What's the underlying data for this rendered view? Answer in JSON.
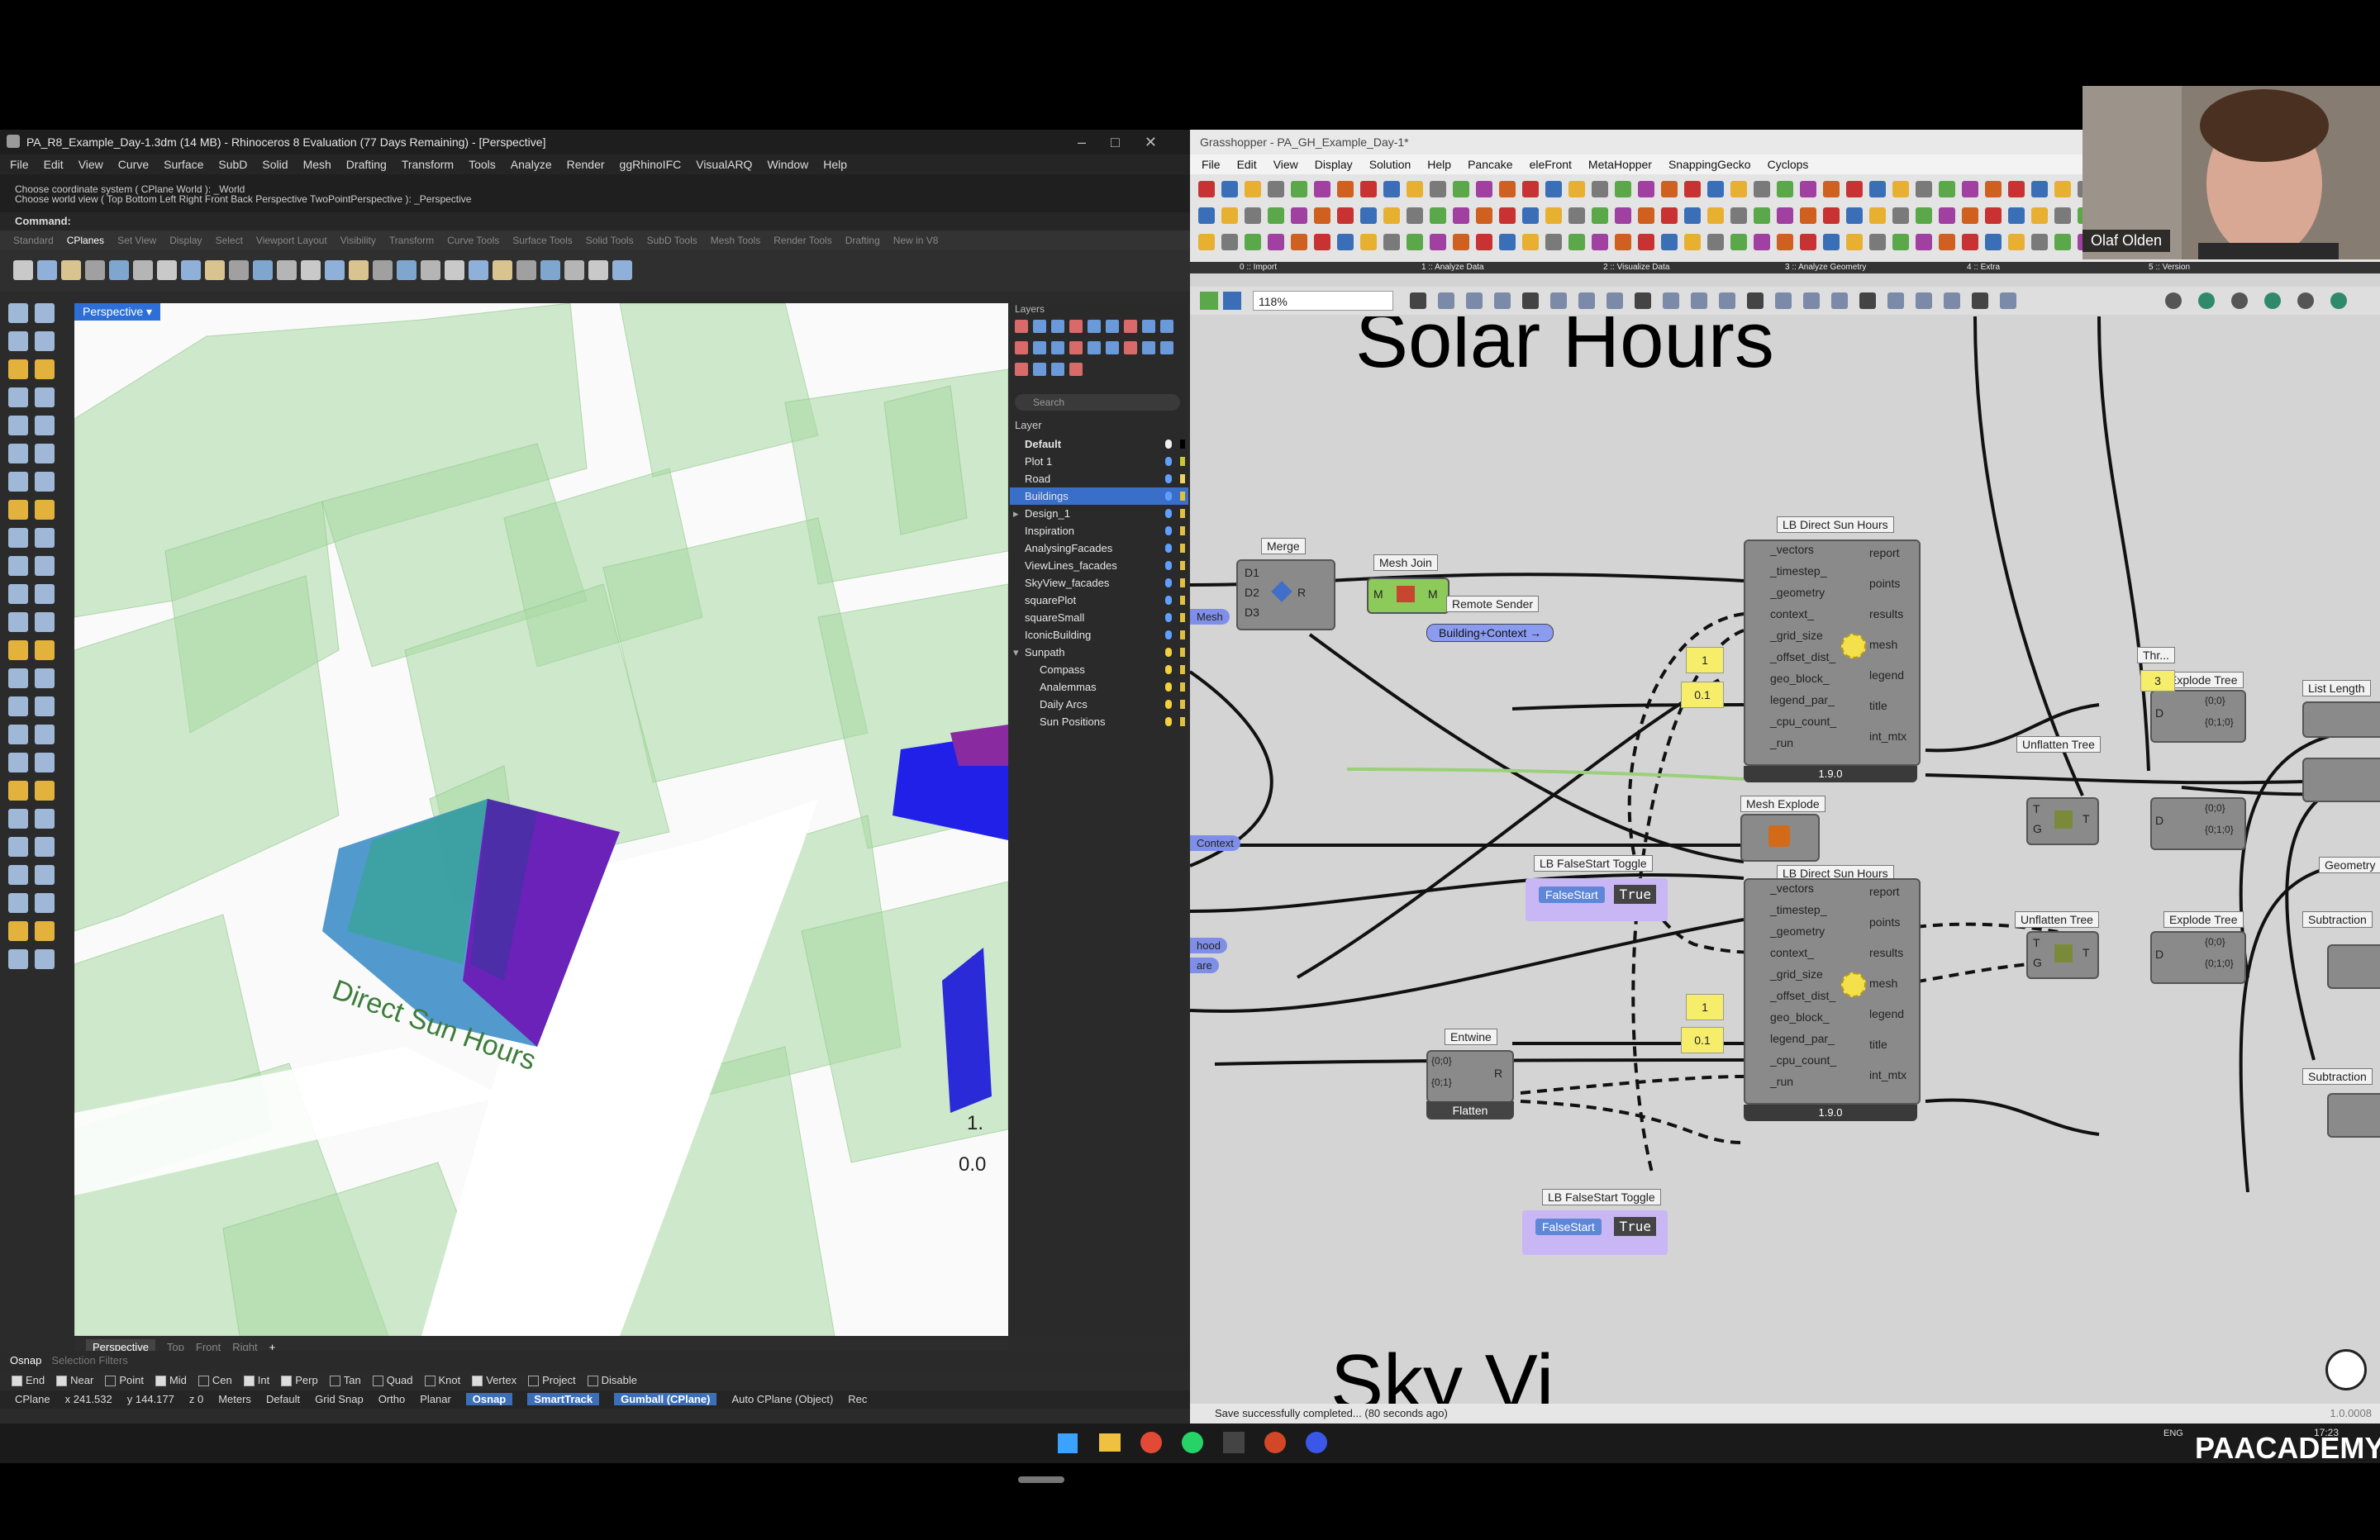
{
  "rhino": {
    "title": "PA_R8_Example_Day-1.3dm (14 MB) - Rhinoceros 8 Evaluation (77 Days Remaining) - [Perspective]",
    "menu": [
      "File",
      "Edit",
      "View",
      "Curve",
      "Surface",
      "SubD",
      "Solid",
      "Mesh",
      "Drafting",
      "Transform",
      "Tools",
      "Analyze",
      "Render",
      "ggRhinoIFC",
      "VisualARQ",
      "Window",
      "Help"
    ],
    "history": [
      "Choose coordinate system ( CPlane World ): _World",
      "Choose world view ( Top Bottom Left Right Front Back Perspective TwoPointPerspective ): _Perspective"
    ],
    "command_label": "Command:",
    "toolbar_tabs": [
      "Standard",
      "CPlanes",
      "Set View",
      "Display",
      "Select",
      "Viewport Layout",
      "Visibility",
      "Transform",
      "Curve Tools",
      "Surface Tools",
      "Solid Tools",
      "SubD Tools",
      "Mesh Tools",
      "Render Tools",
      "Drafting",
      "New in V8"
    ],
    "active_tab": "CPlanes",
    "viewport_label": "Perspective",
    "viewport_text": "Direct Sun Hours",
    "legend_values": [
      "1.",
      "0.0"
    ],
    "viewport_tabs": [
      "Perspective",
      "Top",
      "Front",
      "Right"
    ],
    "viewport_add": "+",
    "layers_title": "Layers",
    "search_placeholder": "Search",
    "layer_column": "Layer",
    "layers": [
      {
        "name": "Default",
        "color": "#000000",
        "bulb": "#f0f0f0",
        "indent": 0
      },
      {
        "name": "Plot 1",
        "color": "#c8c832",
        "bulb": "#5fa0ff",
        "indent": 0
      },
      {
        "name": "Road",
        "color": "#f0d060",
        "bulb": "#5fa0ff",
        "indent": 0
      },
      {
        "name": "Buildings",
        "color": "#e0c040",
        "bulb": "#5fa0ff",
        "indent": 0,
        "selected": true
      },
      {
        "name": "Design_1",
        "color": "#e0c040",
        "bulb": "#5fa0ff",
        "indent": 0,
        "expander": "▸"
      },
      {
        "name": "Inspiration",
        "color": "#e0c040",
        "bulb": "#5fa0ff",
        "indent": 0
      },
      {
        "name": "AnalysingFacades",
        "color": "#e0c040",
        "bulb": "#5fa0ff",
        "indent": 0
      },
      {
        "name": "ViewLines_facades",
        "color": "#e0c040",
        "bulb": "#5fa0ff",
        "indent": 0
      },
      {
        "name": "SkyView_facades",
        "color": "#e0c040",
        "bulb": "#5fa0ff",
        "indent": 0
      },
      {
        "name": "squarePlot",
        "color": "#e0c040",
        "bulb": "#5fa0ff",
        "indent": 0
      },
      {
        "name": "squareSmall",
        "color": "#e0c040",
        "bulb": "#5fa0ff",
        "indent": 0
      },
      {
        "name": "IconicBuilding",
        "color": "#e0c040",
        "bulb": "#5fa0ff",
        "indent": 0
      },
      {
        "name": "Sunpath",
        "color": "#e0c040",
        "bulb": "#f2d040",
        "indent": 0,
        "expander": "▾"
      },
      {
        "name": "Compass",
        "color": "#e0c040",
        "bulb": "#f2d040",
        "indent": 1
      },
      {
        "name": "Analemmas",
        "color": "#e0c040",
        "bulb": "#f2d040",
        "indent": 1
      },
      {
        "name": "Daily Arcs",
        "color": "#e0c040",
        "bulb": "#f2d040",
        "indent": 1
      },
      {
        "name": "Sun Positions",
        "color": "#e0c040",
        "bulb": "#f2d040",
        "indent": 1
      }
    ],
    "osnap_label": "Osnap",
    "selection_filters": "Selection Filters",
    "osnaps": [
      {
        "name": "End",
        "on": true
      },
      {
        "name": "Near",
        "on": true
      },
      {
        "name": "Point",
        "on": false
      },
      {
        "name": "Mid",
        "on": true
      },
      {
        "name": "Cen",
        "on": false
      },
      {
        "name": "Int",
        "on": true
      },
      {
        "name": "Perp",
        "on": true
      },
      {
        "name": "Tan",
        "on": false
      },
      {
        "name": "Quad",
        "on": false
      },
      {
        "name": "Knot",
        "on": false
      },
      {
        "name": "Vertex",
        "on": true
      },
      {
        "name": "Project",
        "on": false
      },
      {
        "name": "Disable",
        "on": false
      }
    ],
    "status": {
      "cplane": "CPlane",
      "x": "x 241.532",
      "y": "y 144.177",
      "z": "z 0",
      "units": "Meters",
      "layer": "Default",
      "grid_snap": "Grid Snap",
      "ortho": "Ortho",
      "planar": "Planar",
      "osnap": "Osnap",
      "smarttrack": "SmartTrack",
      "gumball": "Gumball (CPlane)",
      "auto_cplane": "Auto CPlane (Object)",
      "rec": "Rec"
    }
  },
  "gh": {
    "title": "Grasshopper - PA_GH_Example_Day-1*",
    "menu": [
      "File",
      "Edit",
      "View",
      "Display",
      "Solution",
      "Help",
      "Pancake",
      "eleFront",
      "MetaHopper",
      "SnappingGecko",
      "Cyclops"
    ],
    "ribbon_groups": [
      "0 :: Import",
      "1 :: Analyze Data",
      "2 :: Visualize Data",
      "3 :: Analyze Geometry",
      "4 :: Extra",
      "5 :: Version"
    ],
    "zoom": "118%",
    "canvas_title": "Solar Hours",
    "bottom_partial": "Sky Vi",
    "save_status": "Save successfully completed... (80 seconds ago)",
    "version": "1.0.0008",
    "nodes": {
      "merge": "Merge",
      "merge_inputs": [
        "D1",
        "D2",
        "D3"
      ],
      "merge_out": "R",
      "mesh_join": "Mesh Join",
      "mesh_join_io": [
        "M",
        "M"
      ],
      "remote_sender": "Remote Sender",
      "building_context": "Building+Context",
      "ladybug1": "LB Direct Sun Hours",
      "ladybug2": "LB Direct Sun Hours",
      "lb_inputs": [
        "_vectors",
        "_timestep_",
        "_geometry",
        "context_",
        "_grid_size",
        "_offset_dist_",
        "geo_block_",
        "legend_par_",
        "_cpu_count_",
        "_run"
      ],
      "lb_outputs": [
        "report",
        "points",
        "results",
        "mesh",
        "legend",
        "title",
        "int_mtx"
      ],
      "lb_version": "1.9.0",
      "val1": "1",
      "val2": "0.1",
      "toggle1": "LB FalseStart Toggle",
      "toggle2": "LB FalseStart Toggle",
      "falsestart": "FalseStart",
      "true_val": "True",
      "mesh_explode": "Mesh Explode",
      "entwine": "Entwine",
      "entwine_inputs": [
        "{0;0}",
        "{0;1}"
      ],
      "entwine_out": "R",
      "flatten": "Flatten",
      "mesh_in": "Mesh",
      "context_in": "Context",
      "hood_in": "hood",
      "are_in": "are",
      "unflatten1": "Unflatten Tree",
      "unflatten2": "Unflatten Tree",
      "explode1": "Explode Tree",
      "explode2": "Explode Tree",
      "explode_outs": [
        "{0;0}",
        "{0;1;0}"
      ],
      "threshold": "Thr...",
      "threshold_val": "3",
      "list_length": "List Length",
      "geometry": "Geometry",
      "subtraction1": "Subtraction",
      "subtraction2": "Subtraction"
    }
  },
  "webcam_name": "Olaf Olden",
  "brand": "PAACADEMY",
  "clock": "17:23",
  "lang": "ENG"
}
